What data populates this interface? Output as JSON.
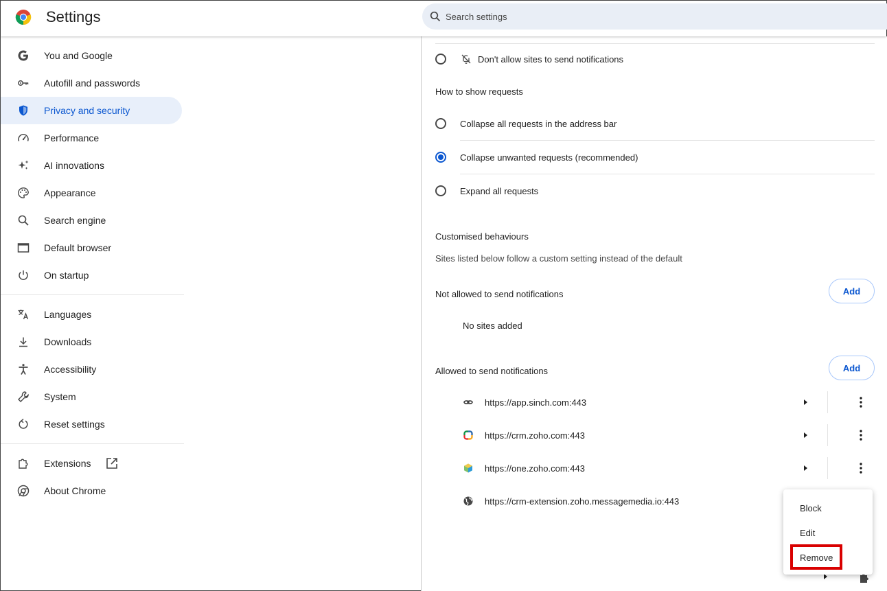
{
  "header": {
    "title": "Settings",
    "search_placeholder": "Search settings"
  },
  "sidebar": {
    "items": [
      {
        "label": "You and Google",
        "icon": "google-g-icon"
      },
      {
        "label": "Autofill and passwords",
        "icon": "key-icon"
      },
      {
        "label": "Privacy and security",
        "icon": "shield-icon",
        "active": true
      },
      {
        "label": "Performance",
        "icon": "speedometer-icon"
      },
      {
        "label": "AI innovations",
        "icon": "sparkle-icon"
      },
      {
        "label": "Appearance",
        "icon": "palette-icon"
      },
      {
        "label": "Search engine",
        "icon": "search-icon"
      },
      {
        "label": "Default browser",
        "icon": "browser-window-icon"
      },
      {
        "label": "On startup",
        "icon": "power-icon"
      },
      {
        "label": "Languages",
        "icon": "translate-icon"
      },
      {
        "label": "Downloads",
        "icon": "download-icon"
      },
      {
        "label": "Accessibility",
        "icon": "accessibility-icon"
      },
      {
        "label": "System",
        "icon": "wrench-icon"
      },
      {
        "label": "Reset settings",
        "icon": "reset-icon"
      },
      {
        "label": "Extensions",
        "icon": "puzzle-icon"
      },
      {
        "label": "About Chrome",
        "icon": "chrome-icon"
      }
    ]
  },
  "main": {
    "dont_allow_label": "Don't allow sites to send notifications",
    "requests_heading": "How to show requests",
    "request_options": [
      {
        "label": "Collapse all requests in the address bar",
        "checked": false
      },
      {
        "label": "Collapse unwanted requests (recommended)",
        "checked": true
      },
      {
        "label": "Expand all requests",
        "checked": false
      }
    ],
    "custom_heading": "Customised behaviours",
    "custom_desc": "Sites listed below follow a custom setting instead of the default",
    "not_allowed_label": "Not allowed to send notifications",
    "add_label": "Add",
    "no_sites": "No sites added",
    "allowed_label": "Allowed to send notifications",
    "sites": [
      {
        "url": "https://app.sinch.com:443",
        "icon": "sinch-icon"
      },
      {
        "url": "https://crm.zoho.com:443",
        "icon": "zoho-crm-icon"
      },
      {
        "url": "https://one.zoho.com:443",
        "icon": "zoho-one-icon"
      },
      {
        "url": "https://crm-extension.zoho.messagemedia.io:443",
        "icon": "globe-icon"
      }
    ]
  },
  "context_menu": {
    "items": [
      "Block",
      "Edit",
      "Remove"
    ]
  },
  "colors": {
    "accent": "#0b57d0",
    "active_bg": "#e8effa",
    "highlight": "#d90000"
  }
}
